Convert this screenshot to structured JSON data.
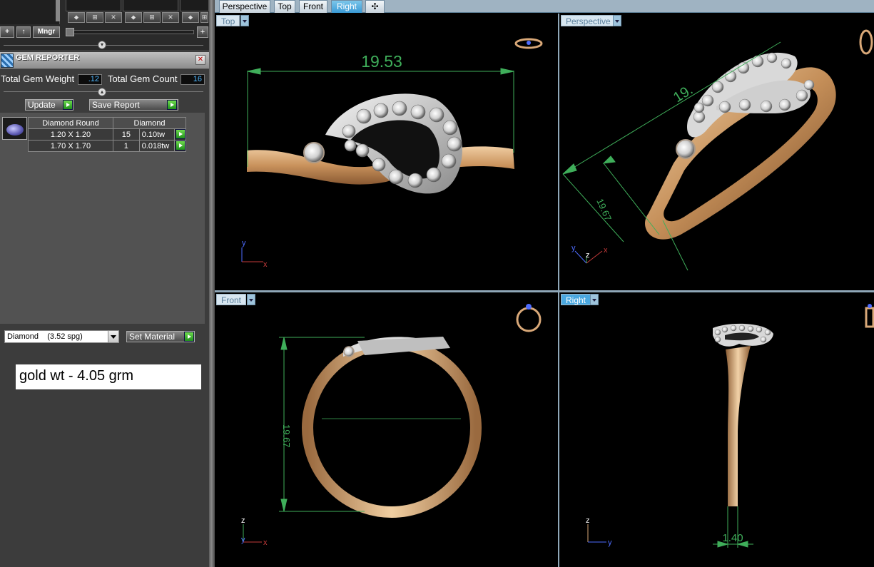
{
  "toolbar": {
    "add": "+",
    "up": "↑",
    "manager": "Mngr",
    "plus_right": "+",
    "mini_icons": [
      "⬥",
      "⊞",
      "✕"
    ]
  },
  "gem_reporter": {
    "title": "GEM REPORTER",
    "close": "✕",
    "total_weight_label": "Total Gem Weight",
    "total_weight_value": ".12",
    "total_count_label": "Total Gem Count",
    "total_count_value": "16",
    "update_label": "Update",
    "save_report_label": "Save Report",
    "table": {
      "headers": [
        "Diamond Round",
        "Diamond"
      ],
      "rows": [
        {
          "size": "1.20 X 1.20",
          "count": "15",
          "weight": "0.10tw"
        },
        {
          "size": "1.70 X 1.70",
          "count": "1",
          "weight": "0.018tw"
        }
      ]
    }
  },
  "material": {
    "selected": "Diamond    (3.52 spg)",
    "set_label": "Set Material"
  },
  "note": "gold wt - 4.05 grm",
  "tabs": [
    "Perspective",
    "Top",
    "Front",
    "Right",
    "✣"
  ],
  "active_tab": "Right",
  "viewports": {
    "top": {
      "label": "Top",
      "dimension": "19.53",
      "axis_1": "y",
      "axis_2": "x"
    },
    "perspective": {
      "label": "Perspective",
      "dimension_1": "19.",
      "dimension_2": "19.67",
      "axis_1": "y",
      "axis_2": "z",
      "axis_3": "x"
    },
    "front": {
      "label": "Front",
      "dimension": "19.67",
      "axis_1": "z",
      "axis_2": "y",
      "axis_3": "x"
    },
    "right": {
      "label": "Right",
      "dimension": "1.40",
      "axis_1": "z",
      "axis_2": "y"
    }
  },
  "colors": {
    "dimension_green": "#3fae5a",
    "gold": "#d9a878",
    "silver": "#d8d8d8",
    "viewport_active": "#4aa8e0"
  }
}
